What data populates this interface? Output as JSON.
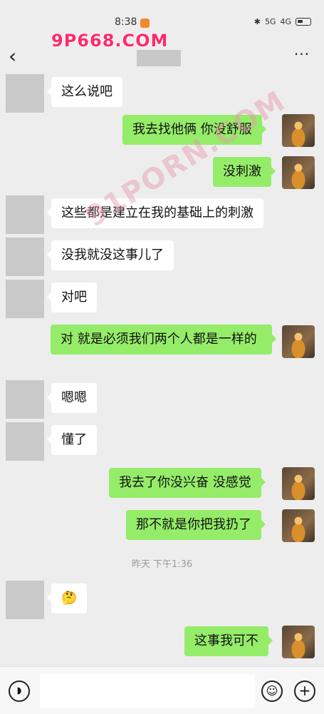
{
  "status_bar": {
    "time": "8:38",
    "signal_1": "5G",
    "signal_2": "4G"
  },
  "watermarks": {
    "top": "9P668.COM",
    "diagonal": "91PORN.COM"
  },
  "header": {
    "back_icon": "chevron-left-icon",
    "more_icon": "ellipsis-icon",
    "more_label": "···",
    "back_label": "‹"
  },
  "messages": [
    {
      "side": "in",
      "text": "这么说吧"
    },
    {
      "side": "out",
      "text": "我去找他俩  你没舒服"
    },
    {
      "side": "out",
      "text": "没刺激"
    },
    {
      "side": "in",
      "text": "这些都是建立在我的基础上的刺激"
    },
    {
      "side": "in",
      "text": "没我就没这事儿了"
    },
    {
      "side": "in",
      "text": "对吧"
    },
    {
      "side": "out",
      "text": "对  就是必须我们两个人都是一样的"
    },
    {
      "side": "in",
      "text": "嗯嗯"
    },
    {
      "side": "in",
      "text": "懂了"
    },
    {
      "side": "out",
      "text": "我去了你没兴奋  没感觉"
    },
    {
      "side": "out",
      "text": "那不就是你把我扔了"
    },
    {
      "side": "in",
      "text": "🤔"
    },
    {
      "side": "out",
      "text": "这事我可不"
    }
  ],
  "timestamp": "昨天 下午1:36",
  "input_bar": {
    "voice_icon": "voice-icon",
    "emoji_icon": "emoji-icon",
    "plus_icon": "plus-icon",
    "input_value": ""
  }
}
